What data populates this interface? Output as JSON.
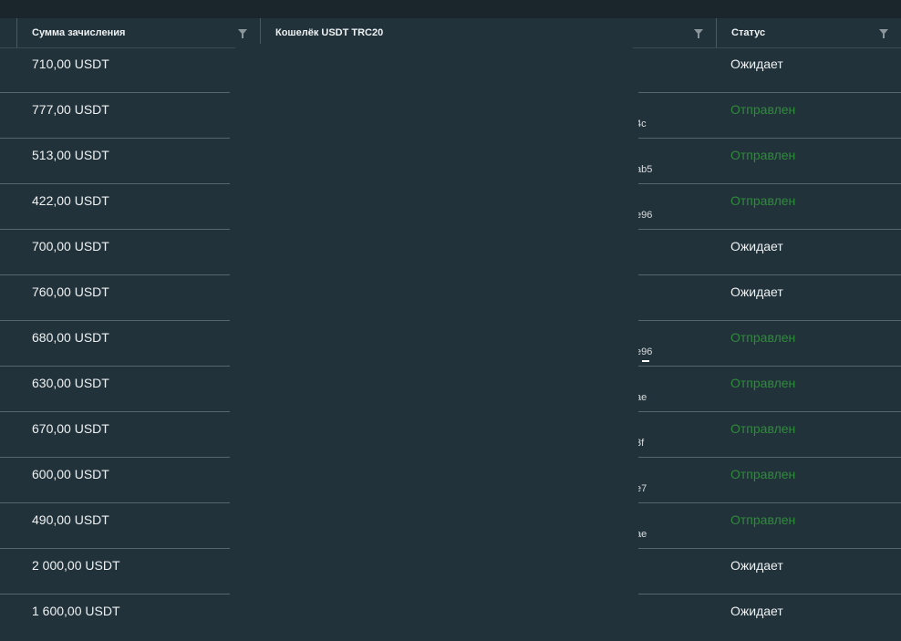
{
  "columns": {
    "amount": "Сумма зачисления",
    "wallet": "Кошелёк USDT TRC20",
    "status": "Статус"
  },
  "colors": {
    "background": "#22323a",
    "sent_status": "#2e8b3a",
    "text": "#eef2f3"
  },
  "icons": {
    "filter": "filter-icon"
  },
  "rows": [
    {
      "amount": "710,00 USDT",
      "wallet": "",
      "status": "Ожидает",
      "state": "pending"
    },
    {
      "amount": "777,00 USDT",
      "wallet": "4c",
      "status": "Отправлен",
      "state": "sent"
    },
    {
      "amount": "513,00 USDT",
      "wallet": "ab5",
      "status": "Отправлен",
      "state": "sent"
    },
    {
      "amount": "422,00 USDT",
      "wallet": "e96",
      "status": "Отправлен",
      "state": "sent"
    },
    {
      "amount": "700,00 USDT",
      "wallet": "",
      "status": "Ожидает",
      "state": "pending"
    },
    {
      "amount": "760,00 USDT",
      "wallet": "",
      "status": "Ожидает",
      "state": "pending"
    },
    {
      "amount": "680,00 USDT",
      "wallet": "e96",
      "status": "Отправлен",
      "state": "sent"
    },
    {
      "amount": "630,00 USDT",
      "wallet": "ae",
      "status": "Отправлен",
      "state": "sent"
    },
    {
      "amount": "670,00 USDT",
      "wallet": "3f",
      "status": "Отправлен",
      "state": "sent"
    },
    {
      "amount": "600,00 USDT",
      "wallet": "e7",
      "status": "Отправлен",
      "state": "sent"
    },
    {
      "amount": "490,00 USDT",
      "wallet": "ae",
      "status": "Отправлен",
      "state": "sent"
    },
    {
      "amount": "2 000,00 USDT",
      "wallet": "",
      "status": "Ожидает",
      "state": "pending"
    },
    {
      "amount": "1 600,00 USDT",
      "wallet": "",
      "status": "Ожидает",
      "state": "pending"
    }
  ]
}
